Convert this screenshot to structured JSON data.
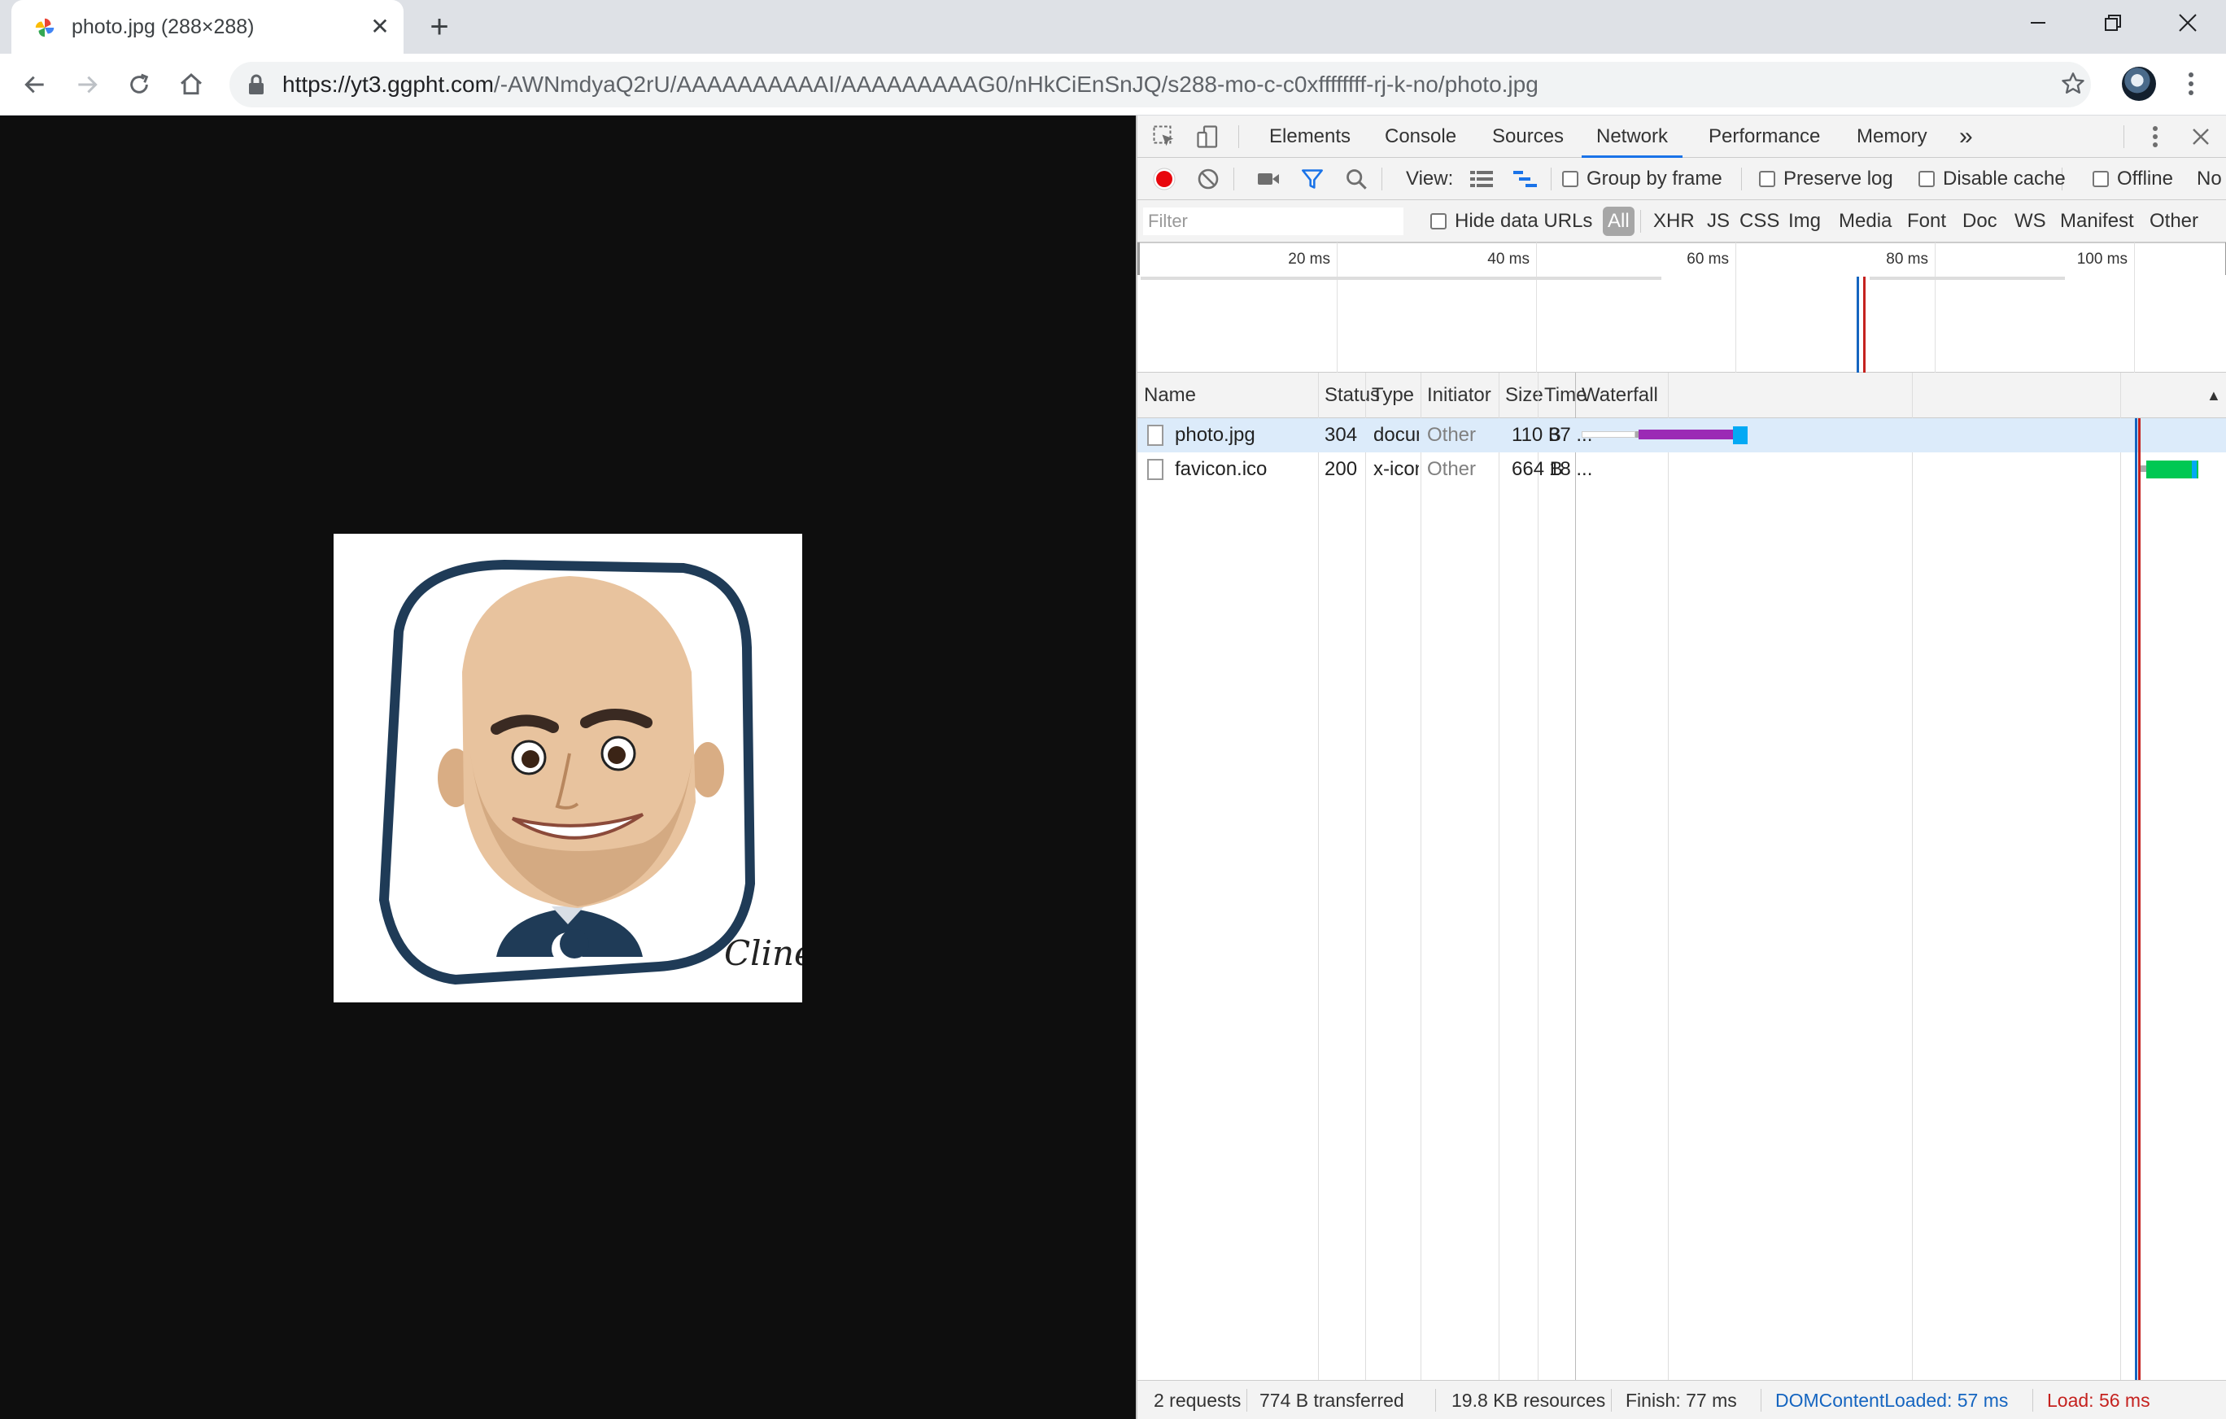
{
  "browser": {
    "tab": {
      "title": "photo.jpg (288×288)",
      "close_glyph": "✕"
    },
    "new_tab_glyph": "+",
    "url": {
      "host": "https://yt3.ggpht.com",
      "path": "/-AWNmdyaQ2rU/AAAAAAAAAAI/AAAAAAAAAG0/nHkCiEnSnJQ/s288-mo-c-c0xffffffff-rj-k-no/photo.jpg"
    }
  },
  "devtools": {
    "tabs": [
      "Elements",
      "Console",
      "Sources",
      "Network",
      "Performance",
      "Memory"
    ],
    "active_tab": "Network",
    "more_tabs_glyph": "»",
    "toolbar": {
      "view_label": "View:",
      "group_by_frame": "Group by frame",
      "preserve_log": "Preserve log",
      "disable_cache": "Disable cache",
      "offline": "Offline",
      "throttle": "No"
    },
    "filter": {
      "placeholder": "Filter",
      "hide_data_urls": "Hide data URLs",
      "types": [
        "All",
        "XHR",
        "JS",
        "CSS",
        "Img",
        "Media",
        "Font",
        "Doc",
        "WS",
        "Manifest",
        "Other"
      ],
      "selected_type": "All"
    },
    "overview": {
      "ticks": [
        "20 ms",
        "40 ms",
        "60 ms",
        "80 ms",
        "100 ms"
      ]
    },
    "columns": {
      "name": "Name",
      "status": "Status",
      "type": "Type",
      "initiator": "Initiator",
      "size": "Size",
      "time": "Time",
      "waterfall": "Waterfall",
      "sort_glyph": "▲"
    },
    "requests": [
      {
        "name": "photo.jpg",
        "status": "304",
        "type": "docum...",
        "initiator": "Other",
        "size": "110 B",
        "time": "37 ...",
        "selected": true
      },
      {
        "name": "favicon.ico",
        "status": "200",
        "type": "x-icon",
        "initiator": "Other",
        "size": "664 B",
        "time": "18 ...",
        "selected": false
      }
    ],
    "status_bar": {
      "requests": "2 requests",
      "transferred": "774 B transferred",
      "resources": "19.8 KB resources",
      "finish": "Finish: 77 ms",
      "dom_content_loaded": "DOMContentLoaded: 57 ms",
      "load": "Load: 56 ms"
    }
  },
  "colors": {
    "record": "#e8060c",
    "dcl_line": "#1565c0",
    "load_line": "#c5221f",
    "waterfall_wait": "#9b2ab5",
    "waterfall_receive": "#03a9f4",
    "waterfall_favicon": "#00c853",
    "caricature_frame": "#1f3b57"
  }
}
